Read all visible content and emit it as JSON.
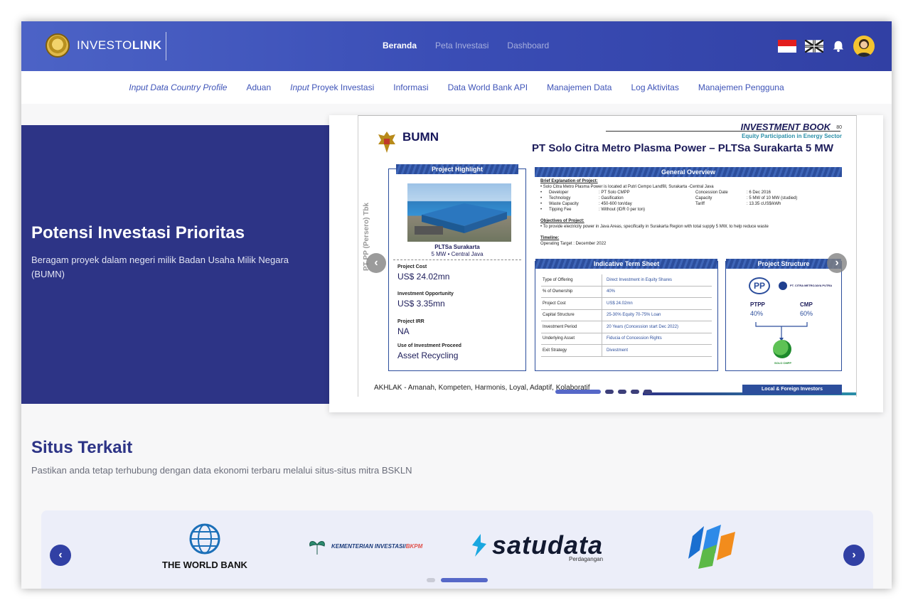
{
  "header": {
    "brand_prefix": "INVESTO",
    "brand_bold": "LINK",
    "nav": [
      "Beranda",
      "Peta Investasi",
      "Dashboard"
    ]
  },
  "submenu": [
    {
      "label": "Input Data Country Profile",
      "italic": true
    },
    {
      "label": "Aduan",
      "italic": false
    },
    {
      "label_italic": "Input",
      "label_rest": " Proyek Investasi"
    },
    {
      "label": "Informasi"
    },
    {
      "label": "Data World Bank API"
    },
    {
      "label": "Manajemen Data"
    },
    {
      "label": "Log Aktivitas"
    },
    {
      "label": "Manajemen Pengguna"
    }
  ],
  "hero": {
    "title": "Potensi Investasi Prioritas",
    "subtitle": "Beragam proyek dalam negeri milik Badan Usaha Milik Negara (BUMN)",
    "slide": {
      "book": "INVESTMENT BOOK",
      "page": "80",
      "sector": "Equity Participation in Energy Sector",
      "title": "PT Solo Citra Metro Plasma Power – PLTSa Surakarta 5 MW",
      "bumn": "BUMN",
      "vertical": "PT PP (Persero) Tbk",
      "highlight": {
        "head": "Project Highlight",
        "caption1": "PLTSa Surakarta",
        "caption2": "5 MW • Central Java",
        "cost_label": "Project Cost",
        "cost_value": "US$ 24.02mn",
        "opp_label": "Investment Opportunity",
        "opp_value": "US$ 3.35mn",
        "irr_label": "Project IRR",
        "irr_value": "NA",
        "use_label": "Use of Investment Proceed",
        "use_value": "Asset Recycling"
      },
      "overview": {
        "head": "General Overview",
        "brief_label": "Brief Explanation of Project:",
        "b1": "Solo Citra Metro Plasma Power is located at Putri Cempo Landfill, Surakarta -Central Java",
        "rows": [
          [
            "Developer",
            ": PT Solo CMPP",
            "Concession Date",
            ": 6 Dec 2016"
          ],
          [
            "Technology",
            ": Gasification",
            "Capacity",
            ": 5 MW of 10 MW (studied)"
          ],
          [
            "Waste Capacity",
            ": 450-600 ton/day",
            "Tariff",
            ": 13.35 cUS$/kWh"
          ],
          [
            "Tipping Fee",
            ": Without (IDR 0 per ton)",
            "",
            ""
          ]
        ],
        "obj_label": "Objectives of  Project:",
        "obj": "To provide electricity power in Java Areas, specifically in Surakarta Region with total supply 5 MW, to help reduce waste",
        "time_label": "Timeline:",
        "time": "Operating Target : December 2022"
      },
      "term_sheet": {
        "head": "Indicative Term Sheet",
        "rows": [
          [
            "Type of Offering",
            "Direct Investment in Equity Shares"
          ],
          [
            "% of Ownership",
            "40%"
          ],
          [
            "Project Cost",
            "US$ 24.02mn"
          ],
          [
            "Capital Structure",
            "25-30% Equity 70-75% Loan"
          ],
          [
            "Investment Period",
            "20 Years (Concession start Dec 2022)"
          ],
          [
            "Underlying Asset",
            "Fiducia of Concession Rights"
          ],
          [
            "Exit Strategy",
            "Divestment"
          ]
        ]
      },
      "structure": {
        "head": "Project Structure",
        "pp": "PP",
        "cmp_name": "PT. CITRA METROJAYA PUTRA",
        "ptpp": "PTPP",
        "ptpp_pct": "40%",
        "cmp": "CMP",
        "cmp_pct": "60%",
        "solo": "SOLO CMPP"
      },
      "footer": "AKHLAK - Amanah, Kompeten, Harmonis, Loyal, Adaptif, Kolaboratif",
      "lfi": "Local & Foreign Investors"
    }
  },
  "related": {
    "title": "Situs Terkait",
    "subtitle": "Pastikan anda tetap terhubung dengan data ekonomi terbaru melalui situs-situs mitra BSKLN",
    "partners": {
      "worldbank": "THE WORLD BANK",
      "kementerian": "KEMENTERIAN INVESTASI/",
      "bkpm": "BKPM",
      "satudata": "satudata",
      "satudata_sub": "Perdagangan"
    }
  },
  "colors": {
    "header_start": "#4c63c6",
    "header_end": "#3140a4",
    "hero_bg": "#2d3486",
    "accent": "#3f54b8"
  }
}
